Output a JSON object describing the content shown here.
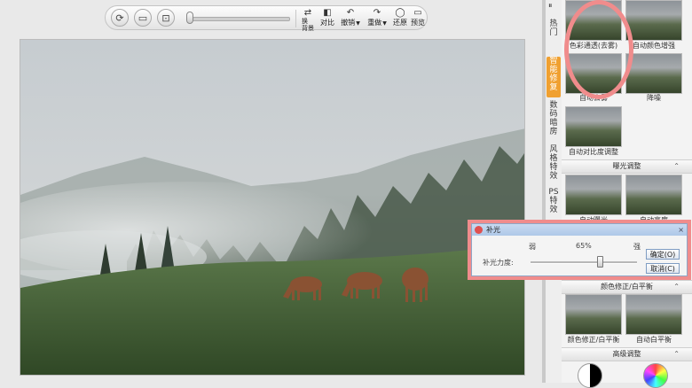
{
  "toolbar": {
    "buttons": [
      {
        "id": "bg",
        "label": "换\n背景",
        "icon": "swap-icon"
      },
      {
        "id": "compare",
        "label": "对比",
        "icon": "compare-icon"
      },
      {
        "id": "undo",
        "label": "撤销",
        "icon": "undo-icon"
      },
      {
        "id": "redo",
        "label": "重做",
        "icon": "redo-icon"
      },
      {
        "id": "restore",
        "label": "还原",
        "icon": "restore-icon"
      },
      {
        "id": "preview",
        "label": "预览",
        "icon": "preview-icon"
      }
    ],
    "rotate_icon": "rotate-icon",
    "monitor_icon": "monitor-icon",
    "fit_icon": "fit-screen-icon"
  },
  "vertical_tabs": [
    {
      "label": "热门",
      "active": false
    },
    {
      "label": "智能修复",
      "active": true
    },
    {
      "label": "数码暗房",
      "active": false
    },
    {
      "label": "风格特效",
      "active": false
    },
    {
      "label": "PS特效",
      "active": false
    }
  ],
  "panel": {
    "thumbs": [
      {
        "label": "色彩通透(去雾)"
      },
      {
        "label": "自动颜色增强"
      },
      {
        "label": "自动去雾"
      },
      {
        "label": "降噪"
      },
      {
        "label": "自动对比度调整"
      }
    ],
    "sections": [
      {
        "label": "曝光调整"
      },
      {
        "label": "颜色修正/白平衡"
      },
      {
        "label": "高级调整"
      }
    ],
    "exposure_thumbs": [
      {
        "label": "自动曝光"
      },
      {
        "label": "自动亮度"
      }
    ],
    "wb_thumbs": [
      {
        "label": "颜色修正/白平衡"
      },
      {
        "label": "自动白平衡"
      }
    ]
  },
  "dialog": {
    "title": "补光",
    "close": "×",
    "weak": "弱",
    "strong": "强",
    "value_label": "65%",
    "value": 0.65,
    "field_label": "补光力度:",
    "ok": "确定(O)",
    "cancel": "取消(C)"
  }
}
